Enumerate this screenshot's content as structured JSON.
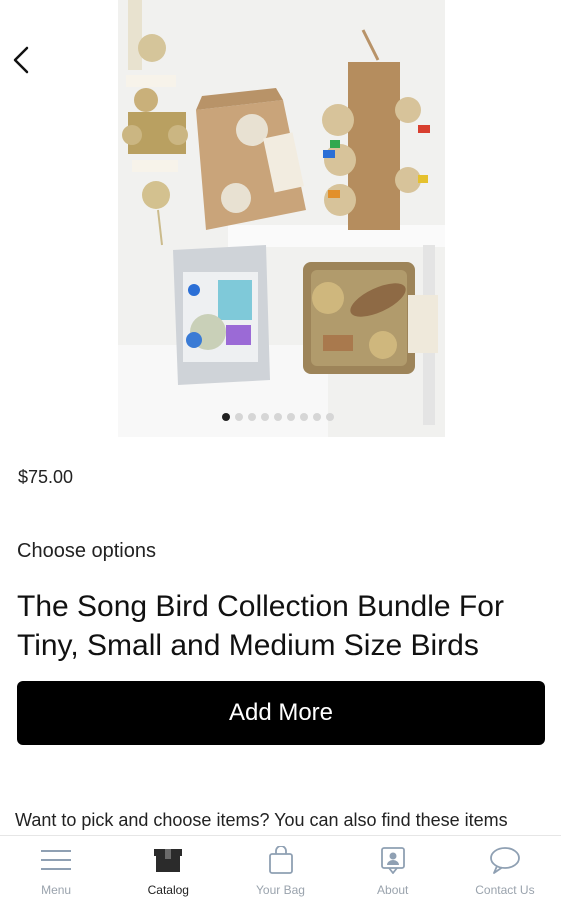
{
  "product": {
    "price": "$75.00",
    "choose_label": "Choose options",
    "title": "The Song Bird Collection Bundle For Tiny, Small and Medium Size Birds",
    "add_button_label": "Add More",
    "description_snippet": "Want to pick and choose items? You can also find these items"
  },
  "carousel": {
    "total_images": 9,
    "active_index": 0
  },
  "tabbar": {
    "items": [
      {
        "label": "Menu",
        "icon": "menu-icon"
      },
      {
        "label": "Catalog",
        "icon": "catalog-icon",
        "active": true
      },
      {
        "label": "Your Bag",
        "icon": "bag-icon"
      },
      {
        "label": "About",
        "icon": "about-icon"
      },
      {
        "label": "Contact Us",
        "icon": "chat-icon"
      }
    ]
  },
  "colors": {
    "accent": "#000000",
    "tab_inactive": "#9aa3ad",
    "tab_active": "#222222"
  }
}
